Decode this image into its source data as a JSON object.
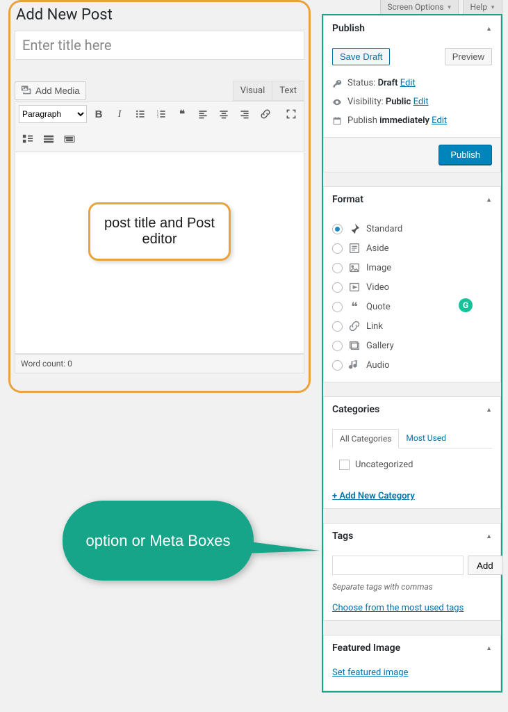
{
  "top_tabs": {
    "screen_options": "Screen Options",
    "help": "Help"
  },
  "editor": {
    "heading": "Add New Post",
    "title_placeholder": "Enter title here",
    "add_media": "Add Media",
    "visual_tab": "Visual",
    "text_tab": "Text",
    "paragraph_select": "Paragraph",
    "annotation": "post title and Post editor",
    "word_count_label": "Word count: 0"
  },
  "publish": {
    "title": "Publish",
    "save_draft": "Save Draft",
    "preview": "Preview",
    "status_label": "Status:",
    "status_value": "Draft",
    "visibility_label": "Visibility:",
    "visibility_value": "Public",
    "schedule_label": "Publish",
    "schedule_value": "immediately",
    "edit": "Edit",
    "publish_btn": "Publish"
  },
  "format": {
    "title": "Format",
    "options": {
      "standard": "Standard",
      "aside": "Aside",
      "image": "Image",
      "video": "Video",
      "quote": "Quote",
      "link": "Link",
      "gallery": "Gallery",
      "audio": "Audio"
    },
    "badge": "G"
  },
  "categories": {
    "title": "Categories",
    "tab_all": "All Categories",
    "tab_most": "Most Used",
    "item_uncat": "Uncategorized",
    "add_link": "+ Add New Category"
  },
  "tags": {
    "title": "Tags",
    "add_btn": "Add",
    "hint": "Separate tags with commas",
    "link": "Choose from the most used tags"
  },
  "featured": {
    "title": "Featured Image",
    "link": "Set featured image"
  },
  "speech": "option or Meta Boxes"
}
